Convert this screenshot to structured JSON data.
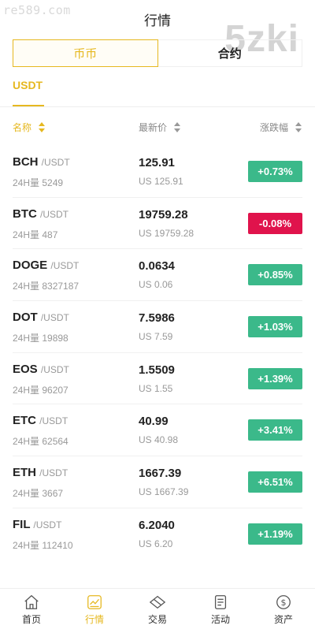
{
  "watermarks": {
    "left": "re589.com",
    "right": "5zki"
  },
  "page_title": "行情",
  "segment": {
    "active": "币币",
    "inactive": "合约"
  },
  "subtab": "USDT",
  "columns": {
    "name": "名称",
    "price": "最新价",
    "change": "涨跌幅"
  },
  "colors": {
    "accent": "#e6b820",
    "up": "#3bb98a",
    "down": "#e0134c"
  },
  "rows": [
    {
      "symbol": "BCH",
      "quote": "/USDT",
      "volume": "24H量 5249",
      "price": "125.91",
      "usd": "US 125.91",
      "change": "+0.73%",
      "direction": "up"
    },
    {
      "symbol": "BTC",
      "quote": "/USDT",
      "volume": "24H量 487",
      "price": "19759.28",
      "usd": "US 19759.28",
      "change": "-0.08%",
      "direction": "down"
    },
    {
      "symbol": "DOGE",
      "quote": "/USDT",
      "volume": "24H量 8327187",
      "price": "0.0634",
      "usd": "US 0.06",
      "change": "+0.85%",
      "direction": "up"
    },
    {
      "symbol": "DOT",
      "quote": "/USDT",
      "volume": "24H量 19898",
      "price": "7.5986",
      "usd": "US 7.59",
      "change": "+1.03%",
      "direction": "up"
    },
    {
      "symbol": "EOS",
      "quote": "/USDT",
      "volume": "24H量 96207",
      "price": "1.5509",
      "usd": "US 1.55",
      "change": "+1.39%",
      "direction": "up"
    },
    {
      "symbol": "ETC",
      "quote": "/USDT",
      "volume": "24H量 62564",
      "price": "40.99",
      "usd": "US 40.98",
      "change": "+3.41%",
      "direction": "up"
    },
    {
      "symbol": "ETH",
      "quote": "/USDT",
      "volume": "24H量 3667",
      "price": "1667.39",
      "usd": "US 1667.39",
      "change": "+6.51%",
      "direction": "up"
    },
    {
      "symbol": "FIL",
      "quote": "/USDT",
      "volume": "24H量 112410",
      "price": "6.2040",
      "usd": "US 6.20",
      "change": "+1.19%",
      "direction": "up"
    }
  ],
  "tabbar": [
    {
      "label": "首页",
      "icon": "home-icon",
      "active": false
    },
    {
      "label": "行情",
      "icon": "chart-icon",
      "active": true
    },
    {
      "label": "交易",
      "icon": "diamond-icon",
      "active": false
    },
    {
      "label": "活动",
      "icon": "document-icon",
      "active": false
    },
    {
      "label": "资产",
      "icon": "dollar-icon",
      "active": false
    }
  ]
}
